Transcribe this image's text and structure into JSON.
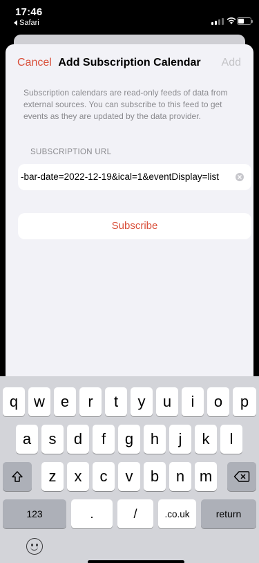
{
  "status_bar": {
    "time": "17:46",
    "back_app": "Safari"
  },
  "nav": {
    "cancel": "Cancel",
    "title": "Add Subscription Calendar",
    "add": "Add"
  },
  "description": "Subscription calendars are read-only feeds of data from external sources. You can subscribe to this feed to get events as they are updated by the data provider.",
  "url_section": {
    "label": "SUBSCRIPTION URL",
    "value": "-bar-date=2022-12-19&ical=1&eventDisplay=list"
  },
  "subscribe_label": "Subscribe",
  "keyboard": {
    "row1": [
      "q",
      "w",
      "e",
      "r",
      "t",
      "y",
      "u",
      "i",
      "o",
      "p"
    ],
    "row2": [
      "a",
      "s",
      "d",
      "f",
      "g",
      "h",
      "j",
      "k",
      "l"
    ],
    "row3": [
      "z",
      "x",
      "c",
      "v",
      "b",
      "n",
      "m"
    ],
    "numbers": "123",
    "dot": ".",
    "slash": "/",
    "domain": ".co.uk",
    "return": "return"
  },
  "colors": {
    "accent": "#d94f3a",
    "disabled": "#c4c4c7",
    "sheet_bg": "#f2f2f7",
    "keyboard_bg": "#d3d4d9"
  },
  "icons": [
    "back-arrow-icon",
    "signal-icon",
    "wifi-icon",
    "battery-icon",
    "clear-icon",
    "shift-icon",
    "delete-icon",
    "emoji-icon"
  ]
}
